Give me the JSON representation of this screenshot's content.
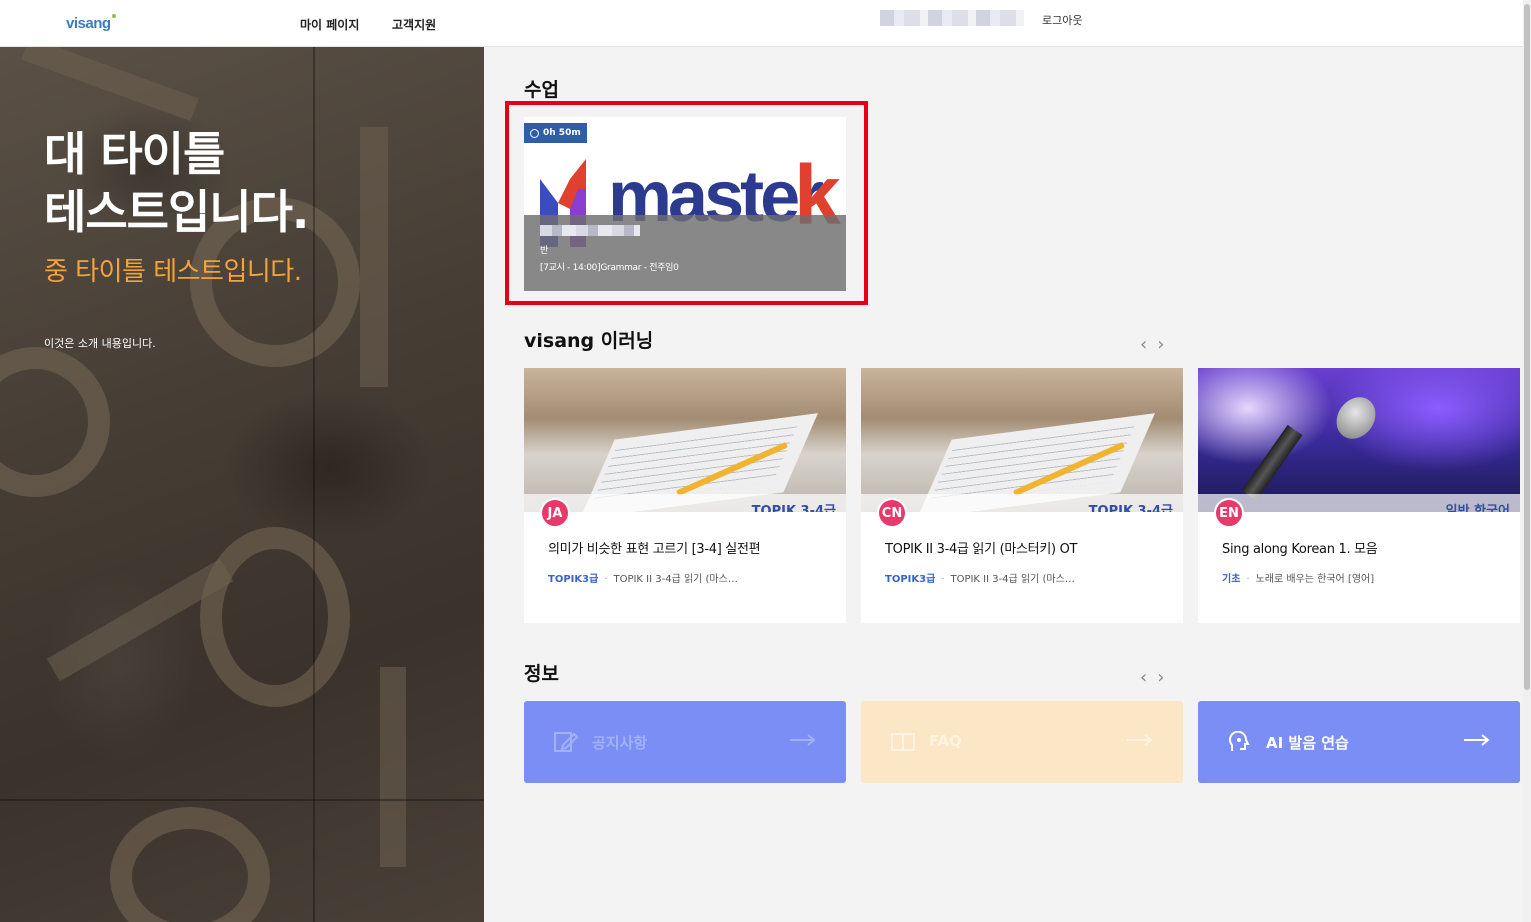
{
  "header": {
    "logo": "visang",
    "nav": [
      "마이 페이지",
      "고객지원"
    ],
    "logout": "로그아웃"
  },
  "hero": {
    "title_line1": "대 타이틀",
    "title_line2": "테스트입니다.",
    "subtitle": "중 타이틀 테스트입니다.",
    "intro": "이것은 소개 내용입니다."
  },
  "classes": {
    "title": "수업",
    "card": {
      "duration": "0h 50m",
      "brand": "master",
      "brand_k": "k",
      "ban": "반",
      "info": "[7교시 - 14:00]Grammar - 전주임0"
    }
  },
  "elearning": {
    "title": "visang 이러닝",
    "prev": "‹",
    "next": "›",
    "courses": [
      {
        "lang": "JA",
        "tag": "TOPIK 3-4급",
        "title": "의미가 비슷한 표현 고르기 [3-4] 실전편",
        "level": "TOPIK3급",
        "sub": "TOPIK II 3-4급 읽기 (마스…"
      },
      {
        "lang": "CN",
        "tag": "TOPIK 3-4급",
        "title": "TOPIK II 3-4급 읽기 (마스터키) OT",
        "level": "TOPIK3급",
        "sub": "TOPIK II 3-4급 읽기 (마스…"
      },
      {
        "lang": "EN",
        "tag": "일반 한국어",
        "title": "Sing along Korean 1. 모음",
        "level": "기초",
        "sub": "노래로 배우는 한국어 [영어]"
      }
    ]
  },
  "info": {
    "title": "정보",
    "prev": "‹",
    "next": "›",
    "cards": [
      {
        "label": "공지사항",
        "icon": "notice-edit-icon",
        "bg": "#7a8ef5",
        "fg": "#a3b1f8"
      },
      {
        "label": "FAQ",
        "icon": "faq-book-icon",
        "bg": "#fbe6c6",
        "fg": "#fff4e4"
      },
      {
        "label": "AI 발음 연습",
        "icon": "ai-voice-icon",
        "bg": "#7a8ef5",
        "fg": "#ffffff"
      }
    ]
  },
  "colors": {
    "accent_blue": "#3a63c8",
    "hero_orange": "#f2a43a",
    "highlight_red": "#e60012",
    "badge_pink": "#e8396b"
  }
}
